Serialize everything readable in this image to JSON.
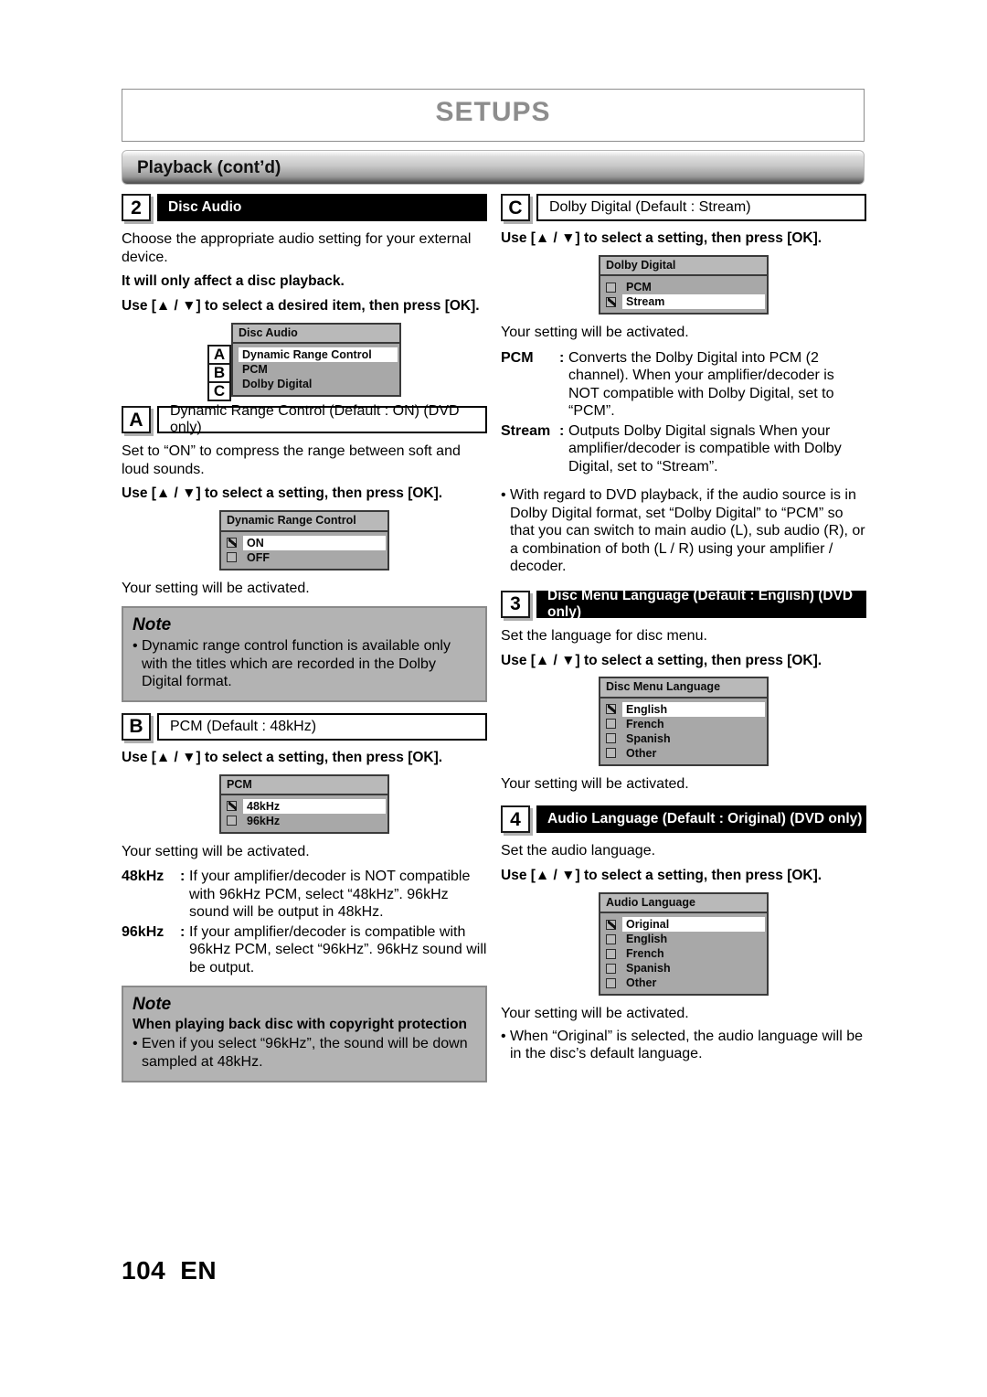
{
  "header": {
    "title": "SETUPS",
    "section_bar": "Playback (cont’d)"
  },
  "footer": {
    "page_number": "104",
    "language_code": "EN"
  },
  "left_column": {
    "section2": {
      "badge": "2",
      "title": "Disc Audio",
      "intro": "Choose the appropriate audio setting for your external device.",
      "bold_note": "It will only affect a disc playback.",
      "instruction": "Use [▲ / ▼] to select a desired item, then press [OK].",
      "menu": {
        "title": "Disc Audio",
        "rows": [
          {
            "label": "Dynamic Range Control",
            "checked": false,
            "selected": true,
            "letter": "A",
            "arrow": true
          },
          {
            "label": "PCM",
            "checked": false,
            "selected": false,
            "letter": "B",
            "arrow": false
          },
          {
            "label": "Dolby Digital",
            "checked": false,
            "selected": false,
            "letter": "C",
            "arrow": false
          }
        ]
      }
    },
    "sectionA": {
      "badge": "A",
      "title": "Dynamic Range Control (Default : ON)   (DVD only)",
      "intro": "Set to “ON” to compress the range between soft and loud sounds.",
      "instruction": "Use [▲ / ▼] to select a setting, then press [OK].",
      "menu": {
        "title": "Dynamic Range Control",
        "rows": [
          {
            "label": "ON",
            "checked": true,
            "selected": true
          },
          {
            "label": "OFF",
            "checked": false,
            "selected": false
          }
        ]
      },
      "activated": "Your setting will be activated.",
      "note": {
        "title": "Note",
        "bullets": [
          "Dynamic range control function is available only with the titles which are recorded in the Dolby Digital format."
        ]
      }
    },
    "sectionB": {
      "badge": "B",
      "title": "PCM (Default : 48kHz)",
      "instruction": "Use [▲ / ▼] to select a setting, then press [OK].",
      "menu": {
        "title": "PCM",
        "rows": [
          {
            "label": "48kHz",
            "checked": true,
            "selected": true
          },
          {
            "label": "96kHz",
            "checked": false,
            "selected": false
          }
        ]
      },
      "activated": "Your setting will be activated.",
      "definitions": [
        {
          "term": "48kHz",
          "colon": ":",
          "desc": "If your amplifier/decoder is NOT compatible with 96kHz PCM, select “48kHz”. 96kHz sound will be output in 48kHz."
        },
        {
          "term": "96kHz",
          "colon": ":",
          "desc": "If your amplifier/decoder is compatible with 96kHz PCM, select “96kHz”. 96kHz sound will be output."
        }
      ],
      "note": {
        "title": "Note",
        "subtitle": "When playing back disc with copyright protection",
        "bullets": [
          "Even if you select “96kHz”, the sound will be down sampled at 48kHz."
        ]
      }
    }
  },
  "right_column": {
    "sectionC": {
      "badge": "C",
      "title": "Dolby Digital (Default : Stream)",
      "instruction": "Use [▲ / ▼] to select a setting, then press [OK].",
      "menu": {
        "title": "Dolby Digital",
        "rows": [
          {
            "label": "PCM",
            "checked": false,
            "selected": false
          },
          {
            "label": "Stream",
            "checked": true,
            "selected": true
          }
        ]
      },
      "activated": "Your setting will be activated.",
      "definitions": [
        {
          "term": "PCM",
          "colon": ":",
          "desc": "Converts the Dolby Digital into PCM (2 channel). When your amplifier/decoder is NOT compatible with Dolby Digital, set to “PCM”."
        },
        {
          "term": "Stream",
          "colon": ":",
          "desc": "Outputs Dolby Digital signals When your amplifier/decoder is compatible with Dolby Digital, set to “Stream”."
        }
      ],
      "bullets": [
        "With regard to DVD playback, if the audio source is in Dolby Digital format, set “Dolby Digital” to “PCM” so that you can switch to main audio (L), sub audio (R), or a combination of both (L / R) using your amplifier / decoder."
      ]
    },
    "section3": {
      "badge": "3",
      "title": "Disc Menu Language (Default : English) (DVD only)",
      "intro": "Set the language for disc menu.",
      "instruction": "Use [▲ / ▼] to select a setting, then press [OK].",
      "menu": {
        "title": "Disc Menu Language",
        "rows": [
          {
            "label": "English",
            "checked": true,
            "selected": true
          },
          {
            "label": "French",
            "checked": false,
            "selected": false
          },
          {
            "label": "Spanish",
            "checked": false,
            "selected": false
          },
          {
            "label": "Other",
            "checked": false,
            "selected": false
          }
        ]
      },
      "activated": "Your setting will be activated."
    },
    "section4": {
      "badge": "4",
      "title": "Audio Language (Default : Original)  (DVD only)",
      "intro": "Set the audio language.",
      "instruction": "Use [▲ / ▼] to select a setting, then press [OK].",
      "menu": {
        "title": "Audio Language",
        "rows": [
          {
            "label": "Original",
            "checked": true,
            "selected": true
          },
          {
            "label": "English",
            "checked": false,
            "selected": false
          },
          {
            "label": "French",
            "checked": false,
            "selected": false
          },
          {
            "label": "Spanish",
            "checked": false,
            "selected": false
          },
          {
            "label": "Other",
            "checked": false,
            "selected": false
          }
        ]
      },
      "activated": "Your setting will be activated.",
      "bullets": [
        "When “Original” is selected, the audio language will be in the disc’s default language."
      ]
    }
  },
  "colors": {
    "heading_bar": "#000000",
    "note_bg": "#b3b3b3",
    "osd_bg": "#a8a8a8",
    "osd_title_bg": "#b9b9b9",
    "setups_title": "#8d8d8d"
  }
}
